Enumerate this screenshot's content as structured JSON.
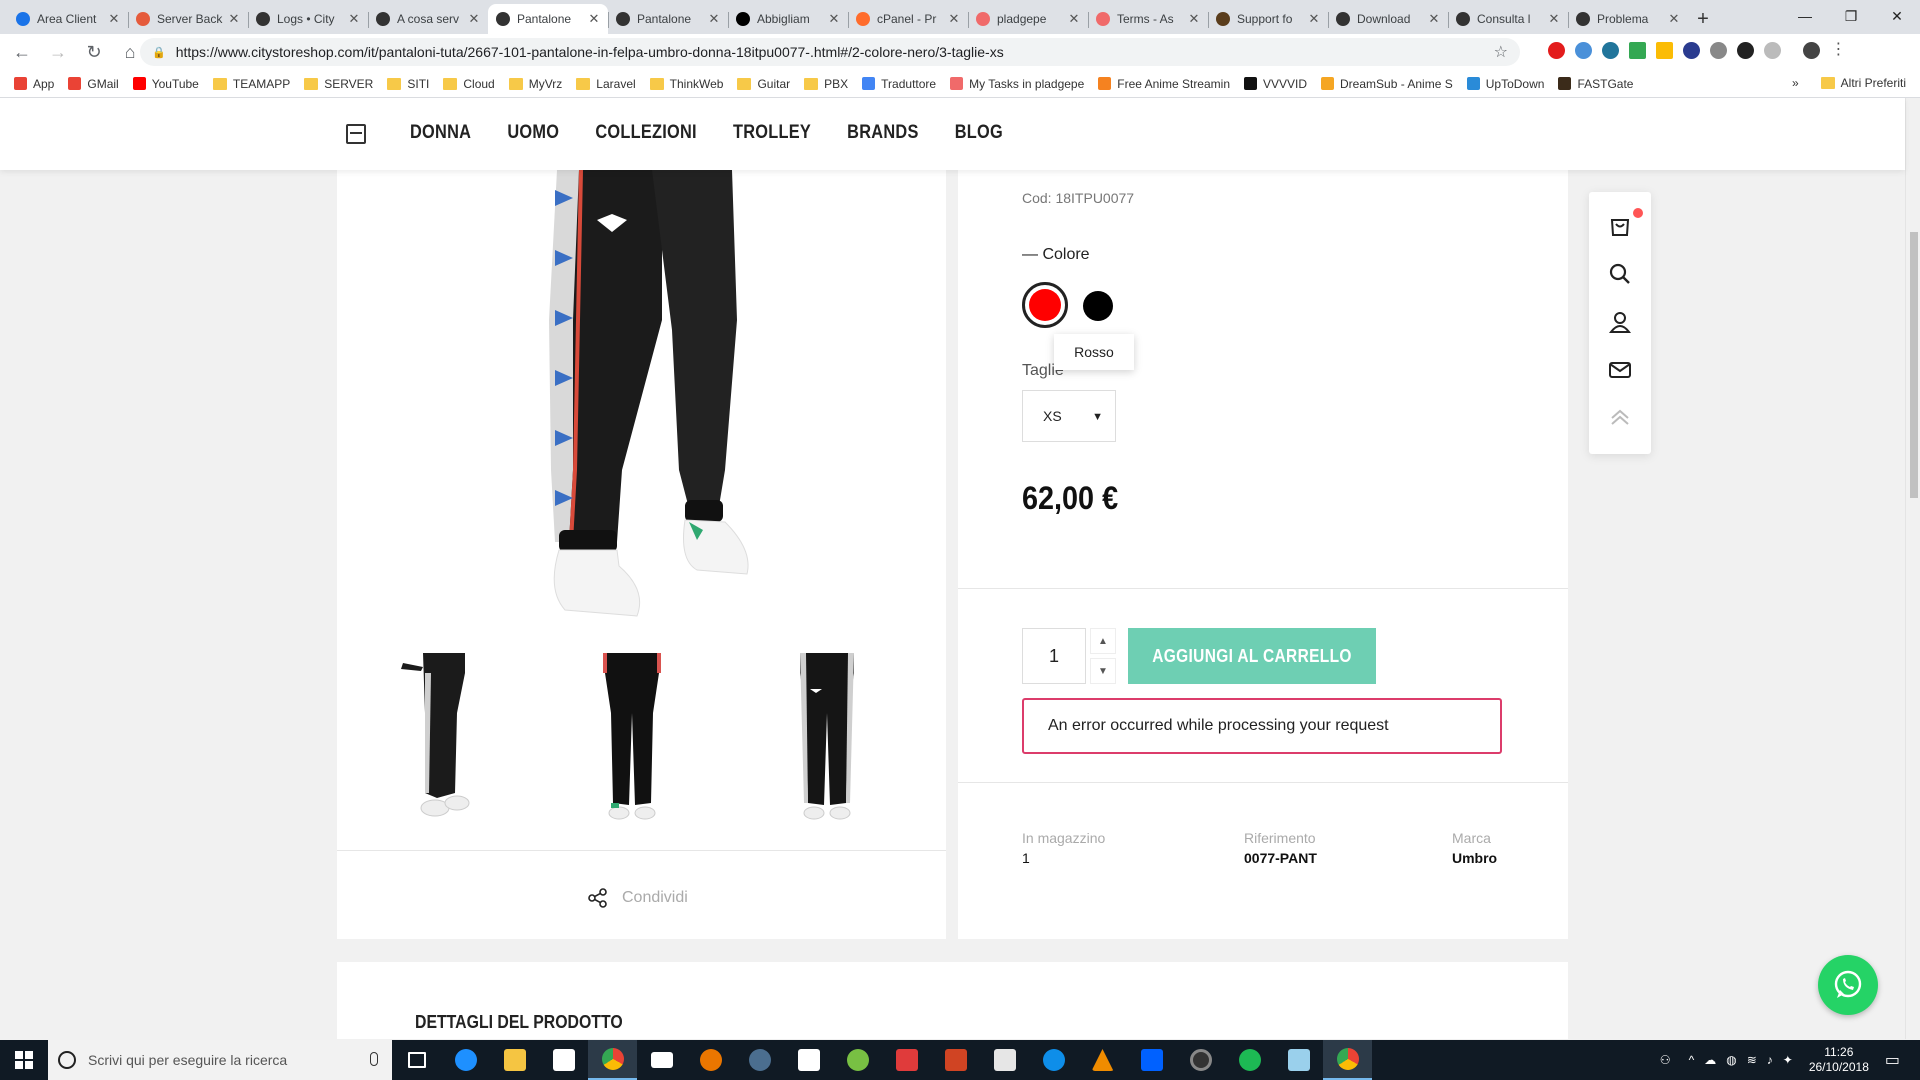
{
  "browser": {
    "tabs": [
      {
        "title": "Area Client",
        "color": "#1a73e8",
        "active": false
      },
      {
        "title": "Server Back",
        "color": "#e55b3c",
        "active": false
      },
      {
        "title": "Logs • City",
        "color": "#333333",
        "active": false
      },
      {
        "title": "A cosa serv",
        "color": "#333333",
        "active": false
      },
      {
        "title": "Pantalone",
        "color": "#333333",
        "active": true
      },
      {
        "title": "Pantalone",
        "color": "#333333",
        "active": false
      },
      {
        "title": "Abbigliam",
        "color": "#000000",
        "active": false
      },
      {
        "title": "cPanel - Pr",
        "color": "#ff6c2c",
        "active": false
      },
      {
        "title": "pladgepe",
        "color": "#f06a6a",
        "active": false
      },
      {
        "title": "Terms - As",
        "color": "#f06a6a",
        "active": false
      },
      {
        "title": "Support fo",
        "color": "#5a3d1c",
        "active": false
      },
      {
        "title": "Download",
        "color": "#333333",
        "active": false
      },
      {
        "title": "Consulta l",
        "color": "#333333",
        "active": false
      },
      {
        "title": "Problema",
        "color": "#333333",
        "active": false
      }
    ],
    "url": "https://www.citystoreshop.com/it/pantaloni-tuta/2667-101-pantalone-in-felpa-umbro-donna-18itpu0077-.html#/2-colore-nero/3-taglie-xs",
    "bookmarks": [
      {
        "label": "App",
        "type": "apps"
      },
      {
        "label": "GMail",
        "type": "gmail"
      },
      {
        "label": "YouTube",
        "type": "youtube"
      },
      {
        "label": "TEAMAPP",
        "type": "folder"
      },
      {
        "label": "SERVER",
        "type": "folder"
      },
      {
        "label": "SITI",
        "type": "folder"
      },
      {
        "label": "Cloud",
        "type": "folder"
      },
      {
        "label": "MyVrz",
        "type": "folder"
      },
      {
        "label": "Laravel",
        "type": "folder"
      },
      {
        "label": "ThinkWeb",
        "type": "folder"
      },
      {
        "label": "Guitar",
        "type": "folder"
      },
      {
        "label": "PBX",
        "type": "folder"
      },
      {
        "label": "Traduttore",
        "type": "translate"
      },
      {
        "label": "My Tasks in pladgepe",
        "type": "asana"
      },
      {
        "label": "Free Anime Streamin",
        "type": "anime"
      },
      {
        "label": "VVVVID",
        "type": "vvvvid"
      },
      {
        "label": "DreamSub - Anime S",
        "type": "dreamsub"
      },
      {
        "label": "UpToDown",
        "type": "uptodown"
      },
      {
        "label": "FASTGate",
        "type": "fastgate"
      }
    ],
    "bookmarks_overflow": "»",
    "other_bookmarks": "Altri Preferiti"
  },
  "site": {
    "menu": [
      "DONNA",
      "UOMO",
      "COLLEZIONI",
      "TROLLEY",
      "BRANDS",
      "BLOG"
    ],
    "share_label": "Condividi",
    "product": {
      "code": "Cod: 18ITPU0077",
      "color_label": "— Colore",
      "color_tooltip": "Rosso",
      "colors": {
        "red": "#ff0000",
        "black": "#000000"
      },
      "size_label": "Taglie",
      "size_selected": "XS",
      "price": "62,00 €",
      "quantity": "1",
      "add_to_cart": "AGGIUNGI AL CARRELLO",
      "error": "An error occurred while processing your request",
      "stock_label": "In magazzino",
      "stock_value": "1",
      "ref_label": "Riferimento",
      "ref_value": "0077-PANT",
      "brand_label": "Marca",
      "brand_value": "Umbro"
    },
    "details_title": "DETTAGLI DEL PRODOTTO",
    "accent": "#6ecfb3",
    "error_color": "#dc3c6b"
  },
  "taskbar": {
    "search_placeholder": "Scrivi qui per eseguire la ricerca",
    "time": "11:26",
    "date": "26/10/2018"
  }
}
